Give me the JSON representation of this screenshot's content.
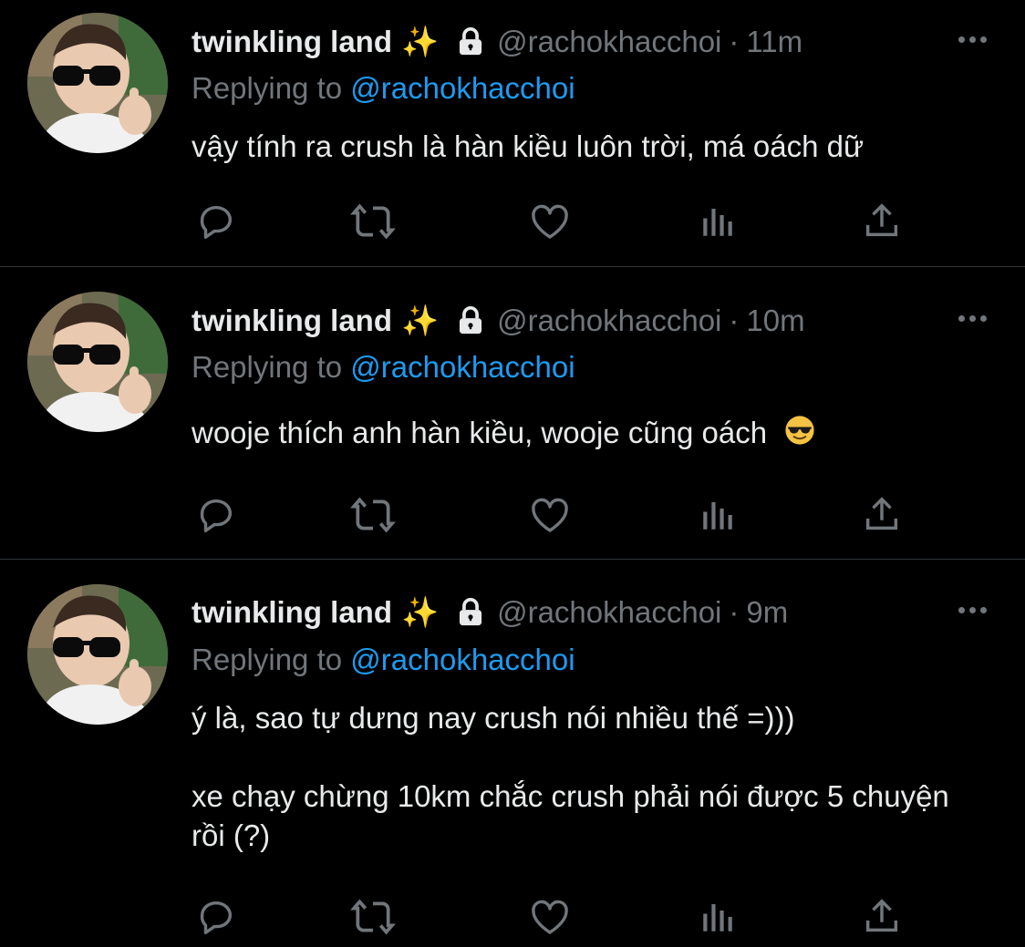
{
  "tweets": [
    {
      "name": "twinkling land",
      "sparkle": "✨",
      "handle": "@rachokhacchoi",
      "separator": "·",
      "time": "11m",
      "replying_prefix": "Replying to",
      "replying_to": "@rachokhacchoi",
      "text_lines": [
        "vậy tính ra crush là hàn kiều luôn trời, má oách dữ"
      ]
    },
    {
      "name": "twinkling land",
      "sparkle": "✨",
      "handle": "@rachokhacchoi",
      "separator": "·",
      "time": "10m",
      "replying_prefix": "Replying to",
      "replying_to": "@rachokhacchoi",
      "text_lines": [
        "wooje thích anh hàn kiều, wooje cũng oách"
      ],
      "text_emoji": "smiling-face-with-sunglasses"
    },
    {
      "name": "twinkling land",
      "sparkle": "✨",
      "handle": "@rachokhacchoi",
      "separator": "·",
      "time": "9m",
      "replying_prefix": "Replying to",
      "replying_to": "@rachokhacchoi",
      "text_lines": [
        "ý là, sao tự dưng nay crush nói nhiều thế =)))",
        "",
        "xe chạy chừng 10km chắc crush phải nói được 5 chuyện rồi (?)"
      ]
    }
  ],
  "icons": {
    "actions": [
      "reply-icon",
      "retweet-icon",
      "like-icon",
      "views-icon",
      "share-icon"
    ],
    "lock": "lock-icon",
    "more": "more-icon"
  },
  "colors": {
    "background": "#000000",
    "primary_text": "#e7e9ea",
    "secondary_text": "#71767b",
    "mention": "#1d9bf0",
    "divider": "#2f3336"
  }
}
